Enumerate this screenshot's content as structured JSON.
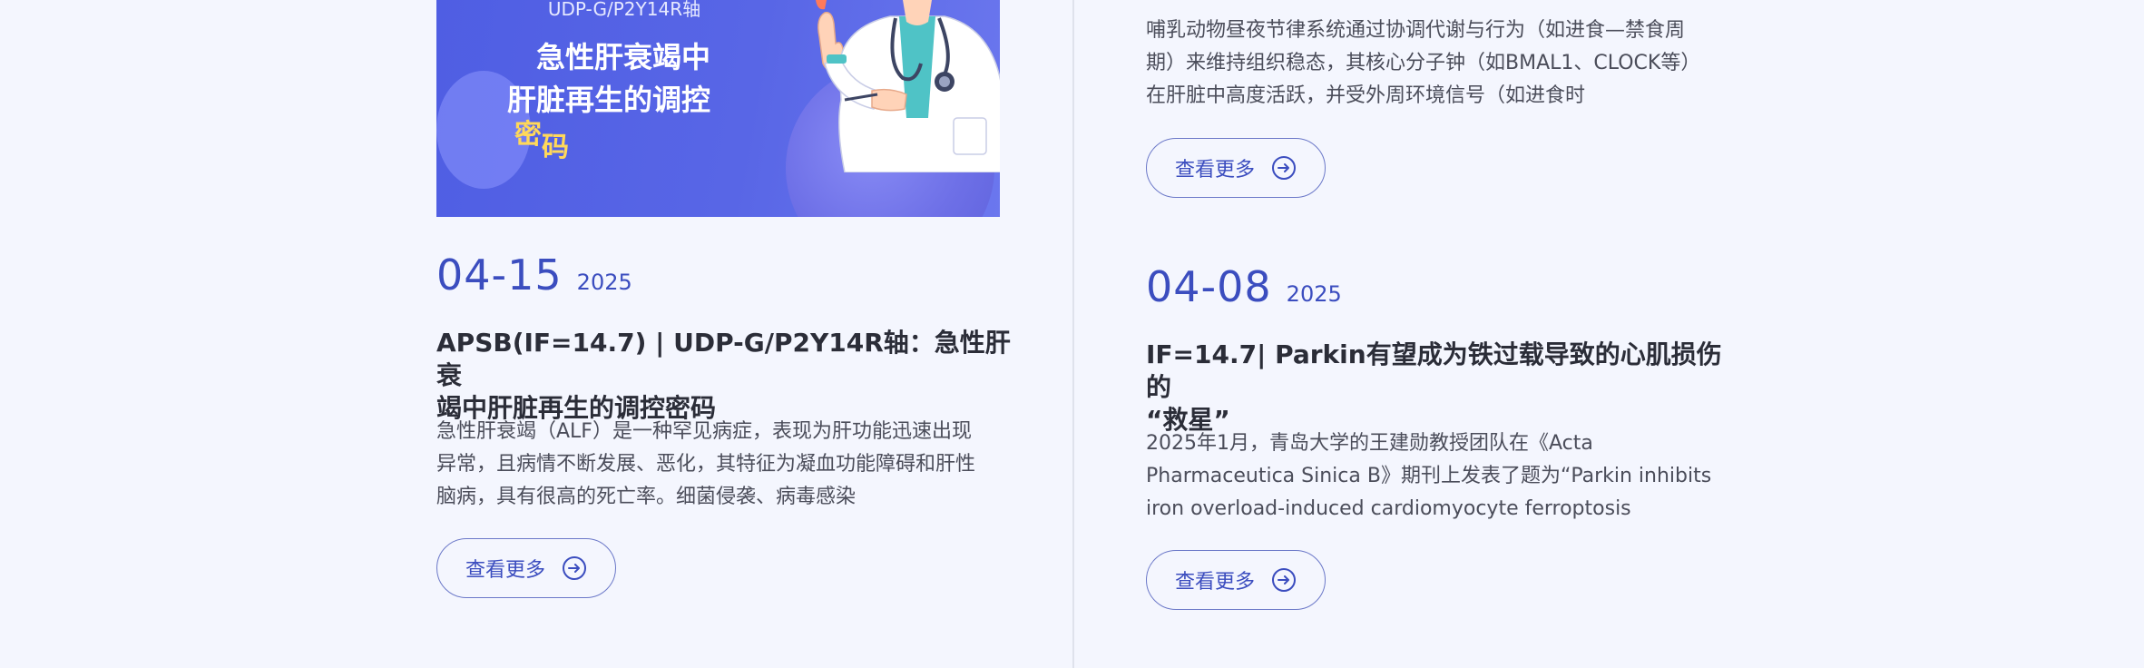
{
  "banner": {
    "subtitle": "UDP-G/P2Y14R轴",
    "line1": "急性肝衰竭中",
    "line2": "肝脏再生的调控",
    "accent_1": "密",
    "accent_2": "码",
    "accent_color": "#ffd85a",
    "bg_color": "#5866e6"
  },
  "left_column": {
    "article": {
      "date": "04-15",
      "year": "2025",
      "title_line1": "APSB(IF=14.7) | UDP-G/P2Y14R轴：急性肝衰",
      "title_line2": "竭中肝脏再生的调控密码",
      "excerpt_line1": "急性肝衰竭（ALF）是一种罕见病症，表现为肝功能迅速出现",
      "excerpt_line2": "异常，且病情不断发展、恶化，其特征为凝血功能障碍和肝性",
      "excerpt_line3": "脑病，具有很高的死亡率。细菌侵袭、病毒感染",
      "more_label": "查看更多"
    }
  },
  "right_column": {
    "top_article": {
      "excerpt_line1": "哺乳动物昼夜节律系统通过协调代谢与行为（如进食—禁食周",
      "excerpt_line2": "期）来维持组织稳态，其核心分子钟（如BMAL1、CLOCK等）",
      "excerpt_line3": "在肝脏中高度活跃，并受外周环境信号（如进食时",
      "more_label": "查看更多"
    },
    "article": {
      "date": "04-08",
      "year": "2025",
      "title_line1": "IF=14.7| Parkin有望成为铁过载导致的心肌损伤的",
      "title_line2": "“救星”",
      "excerpt_line1": "2025年1月，青岛大学的王建勋教授团队在《Acta",
      "excerpt_line2": "Pharmaceutica Sinica B》期刊上发表了题为“Parkin inhibits",
      "excerpt_line3": "iron overload-induced cardiomyocyte ferroptosis",
      "more_label": "查看更多"
    }
  },
  "colors": {
    "page_bg": "#f4f6fe",
    "accent": "#3b4dbf",
    "title_text": "#2b2d38",
    "body_text": "#4b4d5a"
  }
}
